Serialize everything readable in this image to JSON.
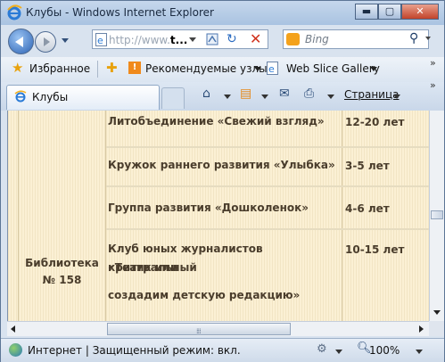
{
  "window": {
    "title": "Клубы - Windows Internet Explorer",
    "minimize": "▬",
    "maximize": "▢",
    "close": "✕"
  },
  "address": {
    "url_prefix": "http://www.",
    "url_bold": "t...",
    "search_placeholder": "Bing"
  },
  "favorites": {
    "label": "Избранное",
    "recommended": "Рекомендуемые узлы",
    "webslice": "Web Slice Gallery",
    "more": "»"
  },
  "tabs": {
    "active_label": "Клубы",
    "more": "»"
  },
  "commandbar": {
    "page_label": "Страница"
  },
  "content": {
    "library": {
      "line1": "Библиотека",
      "line2": "№ 158"
    },
    "rows": [
      {
        "name": "Литобъединение «Свежий взгляд»",
        "age": "12-20 лет"
      },
      {
        "name": "Кружок раннего развития «Улыбка»",
        "age": "3-5  лет"
      },
      {
        "name": "Группа развития «Дошколенок»",
        "age": "4-6 лет"
      },
      {
        "name_line1": "Клуб юных журналистов «Театральный",
        "name_line2": "критик или",
        "name_line3": "создадим детскую редакцию»",
        "age": "10-15 лет"
      }
    ]
  },
  "status": {
    "text": "Интернет | Защищенный режим: вкл.",
    "zoom": "100%"
  },
  "colors": {
    "cell_bg": "#fbf0d4",
    "text": "#4a3d2c",
    "chrome": "#d9e3ef"
  }
}
